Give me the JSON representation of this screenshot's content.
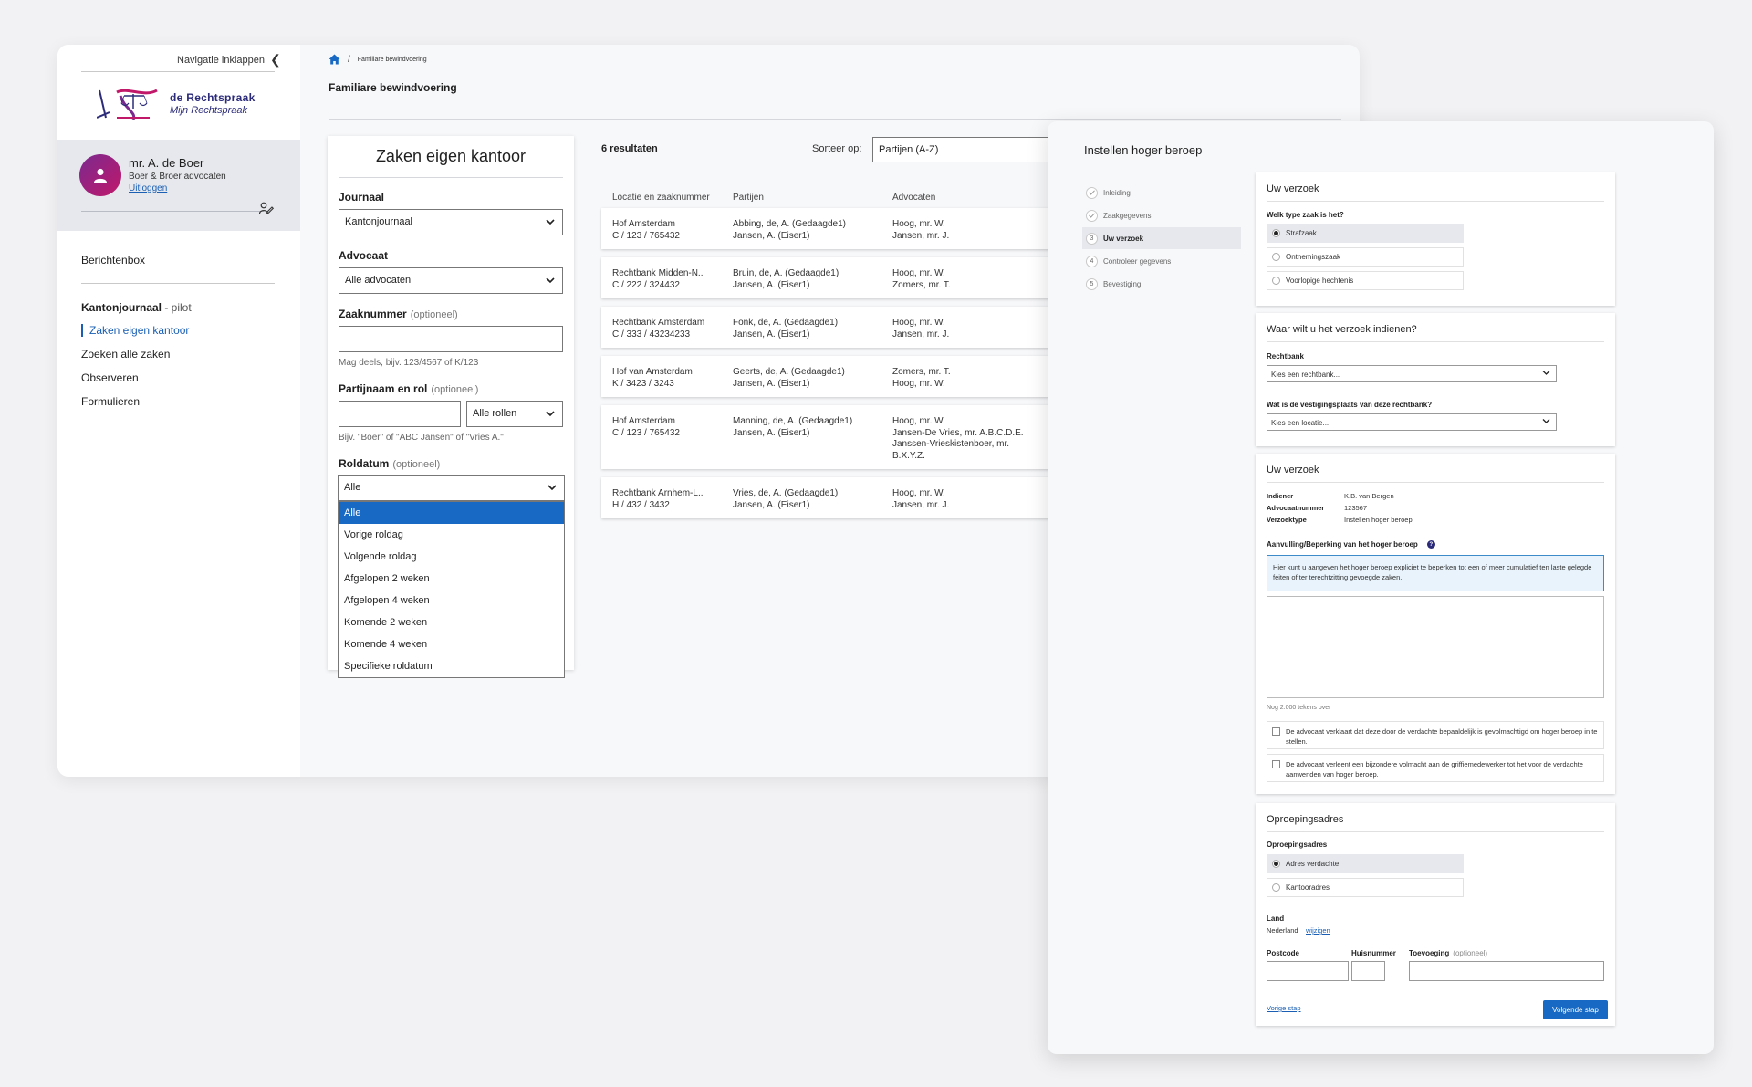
{
  "sidebar": {
    "collapse_label": "Navigatie inklappen",
    "logo_line1": "de Rechtspraak",
    "logo_line2": "Mijn Rechtspraak",
    "user_name": "mr. A. de Boer",
    "user_firm": "Boer & Broer advocaten",
    "logout_label": "Uitloggen",
    "inbox_label": "Berichtenbox",
    "section_bold": "Kantonjournaal",
    "section_muted": " - pilot",
    "items": [
      {
        "label": "Zaken eigen kantoor"
      },
      {
        "label": "Zoeken alle zaken"
      },
      {
        "label": "Observeren"
      },
      {
        "label": "Formulieren"
      }
    ]
  },
  "breadcrumb": {
    "current": "Familiare bewindvoering",
    "separator": "/"
  },
  "page_title": "Familiare bewindvoering",
  "filter": {
    "title": "Zaken eigen kantoor",
    "journaal_label": "Journaal",
    "journaal_value": "Kantonjournaal",
    "advocaat_label": "Advocaat",
    "advocaat_value": "Alle advocaten",
    "zaaknummer_label": "Zaaknummer",
    "optional": "(optioneel)",
    "zaaknummer_hint": "Mag deels, bijv. 123/4567 of K/123",
    "partij_label": "Partijnaam en rol",
    "rol_value": "Alle rollen",
    "partij_hint": "Bijv. \"Boer\" of \"ABC Jansen\" of \"Vries A.\"",
    "roldatum_label": "Roldatum",
    "roldatum_value": "Alle",
    "roldatum_options": [
      "Alle",
      "Vorige roldag",
      "Volgende roldag",
      "Afgelopen 2 weken",
      "Afgelopen 4 weken",
      "Komende 2 weken",
      "Komende 4 weken",
      "Specifieke roldatum"
    ]
  },
  "results": {
    "count_label": "6 resultaten",
    "sort_label": "Sorteer op:",
    "sort_value": "Partijen (A-Z)",
    "columns": [
      "Locatie en zaaknummer",
      "Partijen",
      "Advocaten"
    ],
    "rows": [
      {
        "loc": "Hof Amsterdam",
        "nr": "C / 123 / 765432",
        "p1": "Abbing, de, A. (Gedaagde1)",
        "p2": "Jansen, A. (Eiser1)",
        "a1": "Hoog, mr. W.",
        "a2": "Jansen, mr. J."
      },
      {
        "loc": "Rechtbank Midden-N..",
        "nr": "C / 222 / 324432",
        "p1": "Bruin, de, A. (Gedaagde1)",
        "p2": "Jansen, A. (Eiser1)",
        "a1": "Hoog, mr. W.",
        "a2": "Zomers, mr. T."
      },
      {
        "loc": "Rechtbank Amsterdam",
        "nr": "C / 333 / 43234233",
        "p1": "Fonk, de, A. (Gedaagde1)",
        "p2": "Jansen, A. (Eiser1)",
        "a1": "Hoog, mr. W.",
        "a2": "Jansen, mr. J."
      },
      {
        "loc": "Hof van Amsterdam",
        "nr": "K / 3423 / 3243",
        "p1": "Geerts, de, A. (Gedaagde1)",
        "p2": "Jansen, A. (Eiser1)",
        "a1": "Zomers, mr. T.",
        "a2": "Hoog, mr. W."
      },
      {
        "loc": "Hof Amsterdam",
        "nr": "C / 123 / 765432",
        "p1": "Manning, de, A. (Gedaagde1)",
        "p2": "Jansen, A. (Eiser1)",
        "a1": "Hoog, mr. W.",
        "a2": "Jansen-De Vries, mr. A.B.C.D.E.",
        "a3": "Janssen-Vrieskistenboer, mr.",
        "a4": "B.X.Y.Z."
      },
      {
        "loc": "Rechtbank Arnhem-L..",
        "nr": "H / 432 / 3432",
        "p1": "Vries, de, A. (Gedaagde1)",
        "p2": "Jansen, A. (Eiser1)",
        "a1": "Hoog, mr. W.",
        "a2": "Jansen, mr. J."
      }
    ]
  },
  "appeal": {
    "title": "Instellen hoger beroep",
    "steps": [
      {
        "num": "",
        "label": "Inleiding",
        "state": "done"
      },
      {
        "num": "",
        "label": "Zaakgegevens",
        "state": "done"
      },
      {
        "num": "3",
        "label": "Uw verzoek",
        "state": "active"
      },
      {
        "num": "4",
        "label": "Controleer gegevens",
        "state": "todo"
      },
      {
        "num": "5",
        "label": "Bevestiging",
        "state": "todo"
      }
    ],
    "card1": {
      "title": "Uw verzoek",
      "question": "Welk type zaak is het?",
      "options": [
        "Strafzaak",
        "Ontnemingszaak",
        "Voorlopige hechtenis"
      ]
    },
    "card2": {
      "title": "Waar wilt u het verzoek indienen?",
      "rechtbank_label": "Rechtbank",
      "rechtbank_placeholder": "Kies een rechtbank...",
      "locatie_label": "Wat is de vestigingsplaats van deze rechtbank?",
      "locatie_placeholder": "Kies een locatie..."
    },
    "card3": {
      "title": "Uw verzoek",
      "kv": [
        {
          "k": "Indiener",
          "v": "K.B. van Bergen"
        },
        {
          "k": "Advocaatnummer",
          "v": "123567"
        },
        {
          "k": "Verzoektype",
          "v": "Instellen hoger beroep"
        }
      ],
      "aanvulling_label": "Aanvulling/Beperking van het hoger beroep",
      "help_icon": "?",
      "info_text": "Hier kunt u aangeven het hoger beroep expliciet te beperken tot een of meer cumulatief ten laste gelegde feiten of ter terechtzitting gevoegde zaken.",
      "chars_left": "Nog 2.000 tekens over",
      "check1": "De advocaat verklaart dat deze door de verdachte bepaaldelijk is gevolmachtigd om hoger beroep in te stellen.",
      "check2": "De advocaat verleent een bijzondere volmacht aan de griffiemedewerker tot het voor de verdachte aanwenden van hoger beroep."
    },
    "card4": {
      "title": "Oproepingsadres",
      "question": "Oproepingsadres",
      "options": [
        "Adres verdachte",
        "Kantooradres"
      ],
      "land_label": "Land",
      "land_value": "Nederland",
      "land_change": "wijzigen",
      "postcode_label": "Postcode",
      "huisnummer_label": "Huisnummer",
      "toevoeging_label": "Toevoeging",
      "optional": "(optioneel)",
      "prev_label": "Vorige stap",
      "next_label": "Volgende stap"
    }
  },
  "colors": {
    "accent": "#1769c4",
    "brand": "#2b2b7a",
    "avatar": "#a3217a"
  }
}
